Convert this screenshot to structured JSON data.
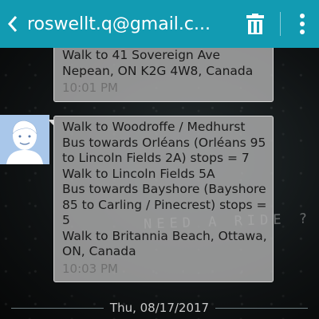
{
  "header": {
    "title": "roswellt.q@gmail.c...",
    "back_icon": "chevron-left-icon",
    "delete_icon": "trash-icon",
    "menu_icon": "more-vertical-icon",
    "color": "#129bb2"
  },
  "messages": [
    {
      "lines": [
        "Walk to 41 Sovereign Ave",
        "Nepean, ON K2G 4W8, Canada"
      ],
      "time": "10:01 PM"
    },
    {
      "lines": [
        "Walk to Woodroffe / Medhurst",
        "Bus towards Orléans (Orléans 95",
        "to Lincoln Fields 2A) stops = 7",
        "Walk to Lincoln Fields 5A",
        "Bus towards Bayshore (Bayshore",
        "85 to Carling / Pinecrest) stops =",
        "5",
        "Walk to Britannia Beach, Ottawa,",
        "ON, Canada"
      ],
      "time": "10:03 PM"
    }
  ],
  "wallpaper": {
    "text": "NEED A RIDE ?"
  },
  "date_divider": "Thu, 08/17/2017"
}
